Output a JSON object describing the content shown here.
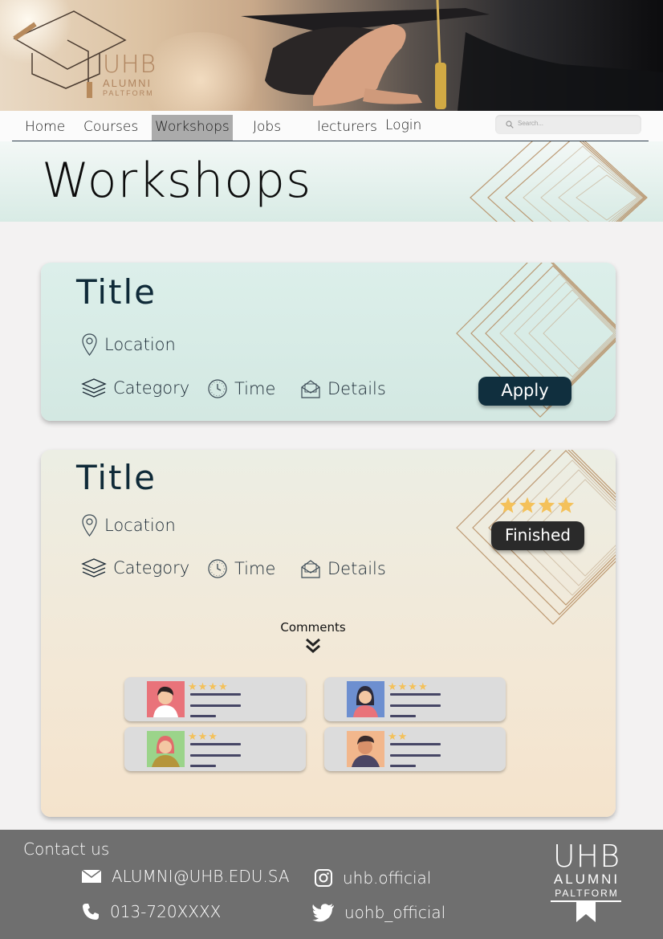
{
  "logo": {
    "name": "UHB",
    "line1": "ALUMNI",
    "line2": "PALTFORM"
  },
  "nav": {
    "items": [
      {
        "label": "Home"
      },
      {
        "label": "Courses"
      },
      {
        "label": "Workshops",
        "active": true
      },
      {
        "label": "Jobs"
      },
      {
        "label": "lecturers"
      },
      {
        "label": "Login"
      }
    ],
    "search_placeholder": "Search..."
  },
  "page": {
    "title": "Workshops"
  },
  "workshops": [
    {
      "title": "Title",
      "location": "Location",
      "category": "Category",
      "time": "Time",
      "details": "Details",
      "action_label": "Apply"
    },
    {
      "title": "Title",
      "location": "Location",
      "category": "Category",
      "time": "Time",
      "details": "Details",
      "status": "Finished",
      "rating": 4,
      "comments_label": "Comments",
      "reviews": [
        {
          "stars": 4
        },
        {
          "stars": 4
        },
        {
          "stars": 3
        },
        {
          "stars": 2
        }
      ]
    }
  ],
  "footer": {
    "heading": "Contact us",
    "email": "ALUMNI@UHB.EDU.SA",
    "phone": "013-720XXXX",
    "instagram": "uhb.official",
    "twitter": "uohb_official"
  },
  "colors": {
    "accent_dark": "#102f3e",
    "star": "#f4c15a",
    "footer_bg": "#6f6f6f",
    "logo_bronze": "#b08560"
  }
}
